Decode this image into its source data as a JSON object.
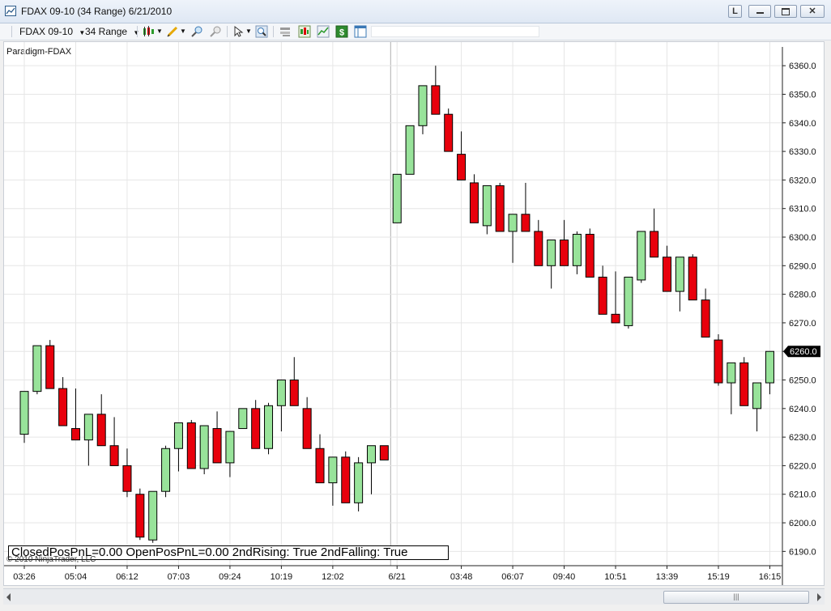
{
  "window": {
    "title": "FDAX 09-10 (34 Range)  6/21/2010",
    "buttons": [
      "L",
      "minimize",
      "restore",
      "close"
    ]
  },
  "toolbar": {
    "instrument": "FDAX 09-10",
    "period": "34 Range",
    "icons": [
      "candlestick-icon",
      "pencil-icon",
      "zoom-in-icon",
      "zoom-out-icon",
      "pointer-icon",
      "magnifier-icon",
      "properties-icon",
      "indicators-icon",
      "strategies-icon",
      "dollar-icon",
      "panel-icon"
    ]
  },
  "chart_label": "Paradigm-FDAX",
  "status_text": "ClosedPosPnL=0.00 OpenPosPnL=0.00 2ndRising: True 2ndFalling: True",
  "copyright": "© 2010 NinjaTrader, LLC",
  "colors": {
    "up": "#98e39a",
    "down": "#e8000c",
    "grid": "#e6e6e6",
    "session": "#b0b0b0"
  },
  "chart_data": {
    "type": "candlestick",
    "ylim": [
      6185,
      6366
    ],
    "price_ticks": [
      6190,
      6200,
      6210,
      6220,
      6230,
      6240,
      6250,
      6260,
      6270,
      6280,
      6290,
      6300,
      6310,
      6320,
      6330,
      6340,
      6350,
      6360
    ],
    "current_price": "6260.0",
    "x_ticks": [
      {
        "label": "03:26",
        "bar": 0
      },
      {
        "label": "05:04",
        "bar": 4
      },
      {
        "label": "06:12",
        "bar": 8
      },
      {
        "label": "07:03",
        "bar": 12
      },
      {
        "label": "09:24",
        "bar": 16
      },
      {
        "label": "10:19",
        "bar": 20
      },
      {
        "label": "12:02",
        "bar": 24
      },
      {
        "label": "6/21",
        "bar": 29
      },
      {
        "label": "03:48",
        "bar": 34
      },
      {
        "label": "06:07",
        "bar": 38
      },
      {
        "label": "09:40",
        "bar": 42
      },
      {
        "label": "10:51",
        "bar": 46
      },
      {
        "label": "13:39",
        "bar": 50
      },
      {
        "label": "15:19",
        "bar": 54
      },
      {
        "label": "16:15",
        "bar": 58
      }
    ],
    "session_break_after_bar": 28,
    "candles": [
      {
        "o": 6231,
        "h": 6246,
        "l": 6228,
        "c": 6246
      },
      {
        "o": 6246,
        "h": 6262,
        "l": 6245,
        "c": 6262
      },
      {
        "o": 6262,
        "h": 6264,
        "l": 6247,
        "c": 6247
      },
      {
        "o": 6247,
        "h": 6251,
        "l": 6234,
        "c": 6234
      },
      {
        "o": 6233,
        "h": 6247,
        "l": 6229,
        "c": 6229
      },
      {
        "o": 6229,
        "h": 6238,
        "l": 6220,
        "c": 6238
      },
      {
        "o": 6238,
        "h": 6245,
        "l": 6227,
        "c": 6227
      },
      {
        "o": 6227,
        "h": 6237,
        "l": 6220,
        "c": 6220
      },
      {
        "o": 6220,
        "h": 6226,
        "l": 6209,
        "c": 6211
      },
      {
        "o": 6210,
        "h": 6212,
        "l": 6194,
        "c": 6195
      },
      {
        "o": 6194,
        "h": 6211,
        "l": 6193,
        "c": 6211
      },
      {
        "o": 6211,
        "h": 6227,
        "l": 6209,
        "c": 6226
      },
      {
        "o": 6226,
        "h": 6235,
        "l": 6218,
        "c": 6235
      },
      {
        "o": 6235,
        "h": 6236,
        "l": 6219,
        "c": 6219
      },
      {
        "o": 6219,
        "h": 6234,
        "l": 6217,
        "c": 6234
      },
      {
        "o": 6233,
        "h": 6239,
        "l": 6221,
        "c": 6221
      },
      {
        "o": 6221,
        "h": 6232,
        "l": 6216,
        "c": 6232
      },
      {
        "o": 6233,
        "h": 6240,
        "l": 6233,
        "c": 6240
      },
      {
        "o": 6240,
        "h": 6243,
        "l": 6226,
        "c": 6226
      },
      {
        "o": 6226,
        "h": 6242,
        "l": 6224,
        "c": 6241
      },
      {
        "o": 6241,
        "h": 6250,
        "l": 6232,
        "c": 6250
      },
      {
        "o": 6250,
        "h": 6258,
        "l": 6241,
        "c": 6241
      },
      {
        "o": 6240,
        "h": 6244,
        "l": 6226,
        "c": 6226
      },
      {
        "o": 6226,
        "h": 6231,
        "l": 6214,
        "c": 6214
      },
      {
        "o": 6214,
        "h": 6223,
        "l": 6206,
        "c": 6223
      },
      {
        "o": 6223,
        "h": 6225,
        "l": 6207,
        "c": 6207
      },
      {
        "o": 6207,
        "h": 6223,
        "l": 6204,
        "c": 6221
      },
      {
        "o": 6221,
        "h": 6227,
        "l": 6210,
        "c": 6227
      },
      {
        "o": 6227,
        "h": 6227,
        "l": 6222,
        "c": 6222
      },
      {
        "o": 6305,
        "h": 6322,
        "l": 6305,
        "c": 6322
      },
      {
        "o": 6322,
        "h": 6339,
        "l": 6322,
        "c": 6339
      },
      {
        "o": 6339,
        "h": 6353,
        "l": 6336,
        "c": 6353
      },
      {
        "o": 6353,
        "h": 6360,
        "l": 6343,
        "c": 6343
      },
      {
        "o": 6343,
        "h": 6345,
        "l": 6330,
        "c": 6330
      },
      {
        "o": 6329,
        "h": 6337,
        "l": 6320,
        "c": 6320
      },
      {
        "o": 6319,
        "h": 6322,
        "l": 6305,
        "c": 6305
      },
      {
        "o": 6304,
        "h": 6318,
        "l": 6301,
        "c": 6318
      },
      {
        "o": 6318,
        "h": 6319,
        "l": 6302,
        "c": 6302
      },
      {
        "o": 6302,
        "h": 6308,
        "l": 6291,
        "c": 6308
      },
      {
        "o": 6308,
        "h": 6319,
        "l": 6302,
        "c": 6302
      },
      {
        "o": 6302,
        "h": 6306,
        "l": 6290,
        "c": 6290
      },
      {
        "o": 6290,
        "h": 6299,
        "l": 6282,
        "c": 6299
      },
      {
        "o": 6299,
        "h": 6306,
        "l": 6290,
        "c": 6290
      },
      {
        "o": 6290,
        "h": 6302,
        "l": 6287,
        "c": 6301
      },
      {
        "o": 6301,
        "h": 6303,
        "l": 6286,
        "c": 6286
      },
      {
        "o": 6286,
        "h": 6290,
        "l": 6273,
        "c": 6273
      },
      {
        "o": 6273,
        "h": 6288,
        "l": 6270,
        "c": 6270
      },
      {
        "o": 6269,
        "h": 6286,
        "l": 6268,
        "c": 6286
      },
      {
        "o": 6285,
        "h": 6302,
        "l": 6284,
        "c": 6302
      },
      {
        "o": 6302,
        "h": 6310,
        "l": 6293,
        "c": 6293
      },
      {
        "o": 6293,
        "h": 6297,
        "l": 6281,
        "c": 6281
      },
      {
        "o": 6281,
        "h": 6293,
        "l": 6274,
        "c": 6293
      },
      {
        "o": 6293,
        "h": 6294,
        "l": 6278,
        "c": 6278
      },
      {
        "o": 6278,
        "h": 6282,
        "l": 6265,
        "c": 6265
      },
      {
        "o": 6264,
        "h": 6266,
        "l": 6248,
        "c": 6249
      },
      {
        "o": 6249,
        "h": 6256,
        "l": 6238,
        "c": 6256
      },
      {
        "o": 6256,
        "h": 6258,
        "l": 6241,
        "c": 6241
      },
      {
        "o": 6240,
        "h": 6249,
        "l": 6232,
        "c": 6249
      },
      {
        "o": 6249,
        "h": 6260,
        "l": 6245,
        "c": 6260
      }
    ]
  }
}
